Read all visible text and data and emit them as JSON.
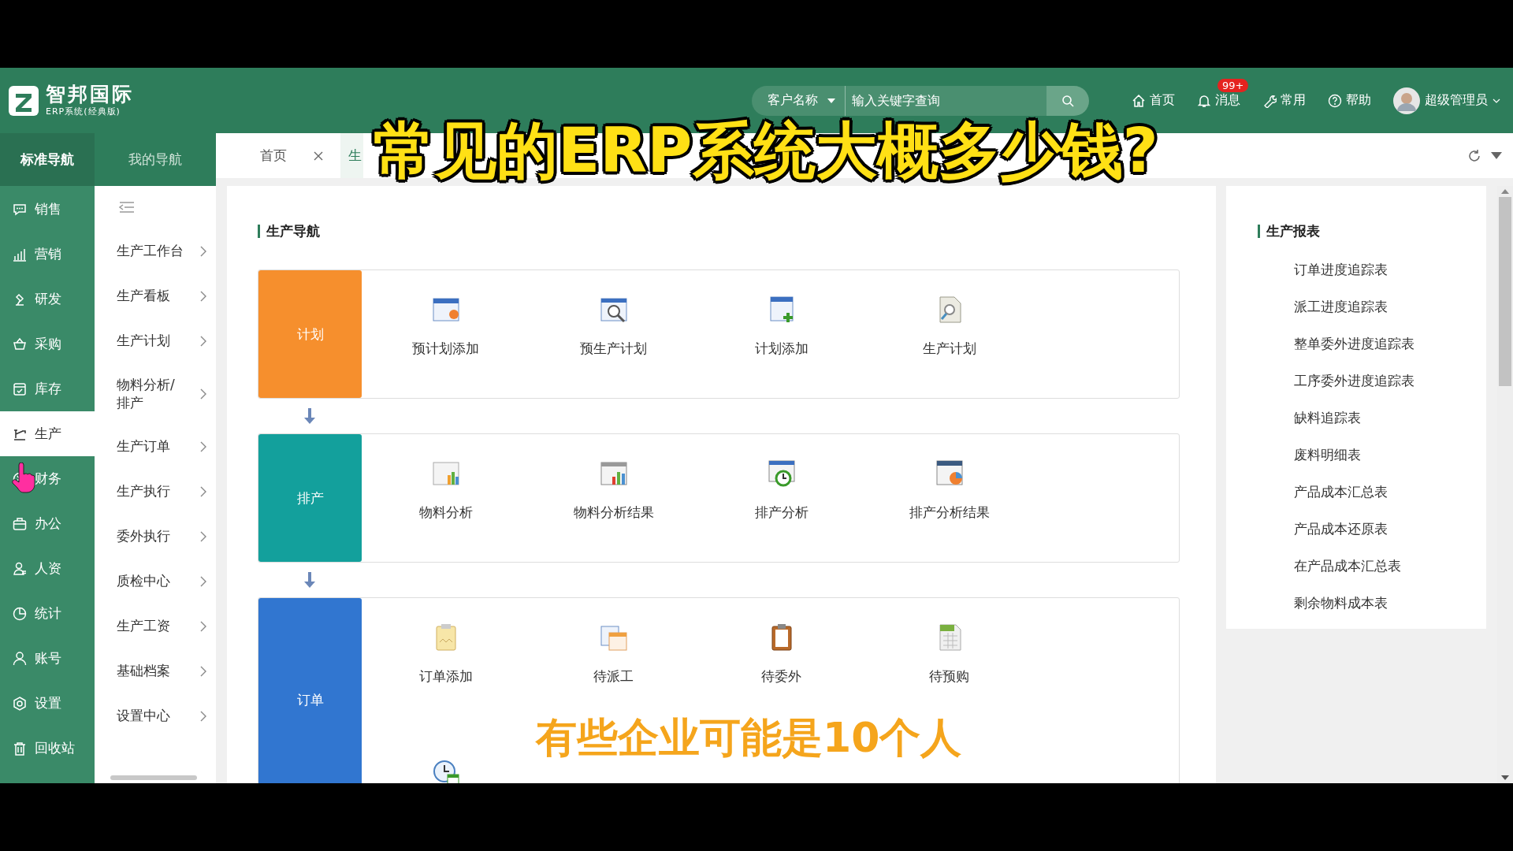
{
  "header": {
    "logo": {
      "title": "智邦国际",
      "subtitle": "ERP系统(经典版)"
    },
    "search": {
      "category": "客户名称",
      "placeholder": "输入关键字查询"
    },
    "nav": [
      {
        "label": "首页"
      },
      {
        "label": "消息",
        "badge": "99+"
      },
      {
        "label": "常用"
      },
      {
        "label": "帮助"
      }
    ],
    "user": {
      "name": "超级管理员"
    }
  },
  "nav_tabs": [
    {
      "label": "标准导航",
      "selected": true
    },
    {
      "label": "我的导航",
      "selected": false
    }
  ],
  "modules": [
    {
      "label": "销售",
      "selected": false
    },
    {
      "label": "营销",
      "selected": false
    },
    {
      "label": "研发",
      "selected": false
    },
    {
      "label": "采购",
      "selected": false
    },
    {
      "label": "库存",
      "selected": false
    },
    {
      "label": "生产",
      "selected": true
    },
    {
      "label": "财务",
      "selected": false
    },
    {
      "label": "办公",
      "selected": false
    },
    {
      "label": "人资",
      "selected": false
    },
    {
      "label": "统计",
      "selected": false
    },
    {
      "label": "账号",
      "selected": false
    },
    {
      "label": "设置",
      "selected": false
    },
    {
      "label": "回收站",
      "selected": false
    }
  ],
  "submenu": [
    "生产工作台",
    "生产看板",
    "生产计划",
    "物料分析/排产",
    "生产订单",
    "生产执行",
    "委外执行",
    "质检中心",
    "生产工资",
    "基础档案",
    "设置中心"
  ],
  "tabs": [
    {
      "label": "首页",
      "closable": true,
      "selected": false
    },
    {
      "label": "生",
      "closable": false,
      "selected": true
    }
  ],
  "production_nav": {
    "title": "生产导航",
    "groups": [
      {
        "label": "计划",
        "color": "#f68f2d",
        "items": [
          {
            "kind": "shortcut",
            "label": "预计划添加"
          },
          {
            "kind": "shortcut",
            "label": "预生产计划"
          },
          {
            "kind": "shortcut",
            "label": "计划添加"
          },
          {
            "kind": "shortcut",
            "label": "生产计划"
          }
        ]
      },
      {
        "label": "排产",
        "color": "#13a09c",
        "items": [
          {
            "kind": "shortcut",
            "label": "物料分析"
          },
          {
            "kind": "shortcut",
            "label": "物料分析结果"
          },
          {
            "kind": "shortcut",
            "label": "排产分析"
          },
          {
            "kind": "shortcut",
            "label": "排产分析结果"
          }
        ]
      },
      {
        "label": "订单",
        "color": "#3176d0",
        "items": [
          {
            "kind": "shortcut",
            "label": "订单添加"
          },
          {
            "kind": "shortcut",
            "label": "待派工"
          },
          {
            "kind": "shortcut",
            "label": "待委外"
          },
          {
            "kind": "shortcut",
            "label": "待预购"
          },
          {
            "kind": "icon_only"
          }
        ]
      }
    ]
  },
  "reports": {
    "title": "生产报表",
    "items": [
      "订单进度追踪表",
      "派工进度追踪表",
      "整单委外进度追踪表",
      "工序委外进度追踪表",
      "缺料追踪表",
      "废料明细表",
      "产品成本汇总表",
      "产品成本还原表",
      "在产品成本汇总表",
      "剩余物料成本表"
    ]
  },
  "captions": [
    {
      "kind": "title",
      "text": "常见的ERP系统大概多少钱?"
    },
    {
      "kind": "subtitle",
      "text": "有些企业可能是10个人"
    }
  ]
}
